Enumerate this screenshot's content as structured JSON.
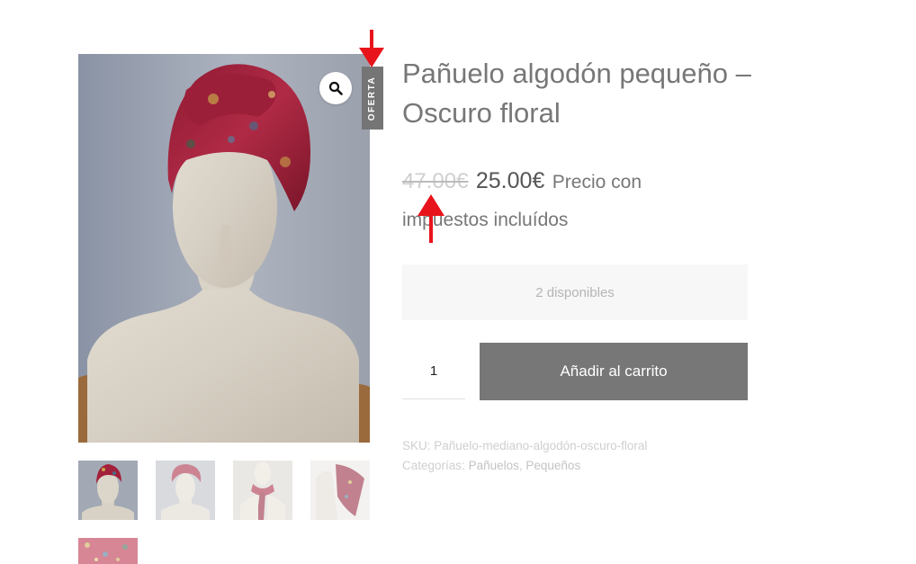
{
  "gallery": {
    "zoom_icon": "magnifier-icon",
    "sale_badge": "OFERTA",
    "thumbnails": [
      {
        "name": "thumb-mannequin-front",
        "active": true
      },
      {
        "name": "thumb-mannequin-turban",
        "active": false
      },
      {
        "name": "thumb-scarf-neck",
        "active": false
      },
      {
        "name": "thumb-scarf-hanging",
        "active": false
      },
      {
        "name": "thumb-fabric-detail",
        "active": false
      }
    ]
  },
  "product": {
    "title": "Pañuelo algodón pequeño – Oscuro floral",
    "price_old": "47.00€",
    "price_new": "25.00€",
    "price_suffix": "Precio con impuestos incluídos",
    "stock": "2 disponibles",
    "quantity": "1",
    "add_to_cart": "Añadir al carrito"
  },
  "meta": {
    "sku_label": "SKU:",
    "sku_value": "Pañuelo-mediano-algodón-oscuro-floral",
    "categories_label": "Categorías:",
    "categories": [
      "Pañuelos",
      "Pequeños"
    ],
    "separator": ","
  },
  "colors": {
    "button": "#777777",
    "badge": "#757575",
    "annotation_arrow": "#e8141b",
    "scarf": "#a3203a"
  }
}
